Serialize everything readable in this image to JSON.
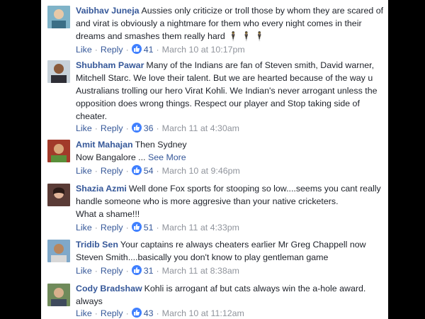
{
  "actions": {
    "like": "Like",
    "reply": "Reply"
  },
  "colors": {
    "name": "#365899",
    "like_badge": "#4080ff",
    "meta": "#90949c"
  },
  "comments": [
    {
      "name": "Vaibhav Juneja",
      "text": "Aussies only criticize or troll those by whom they are scared of and virat is obviously a nightmare for them who every night comes in their dreams and smashes them really hard",
      "emoji": "🕴🕴🕴",
      "likes": "41",
      "time": "March 10 at 10:17pm"
    },
    {
      "name": "Shubham Pawar",
      "text": "Many of the Indians are fan of Steven smith, David warner, Mitchell Starc. We love their talent. But we are hearted because of the way u Australians trolling our hero Virat Kohli. We Indian's never arrogant unless the opposition does wrong things. Respect our player and Stop taking side of cheater.",
      "likes": "36",
      "time": "March 11 at 4:30am"
    },
    {
      "name": "Amit Mahajan",
      "text": "Then Sydney",
      "text2": "Now Bangalore ...",
      "see_more": "See More",
      "likes": "54",
      "time": "March 10 at 9:46pm"
    },
    {
      "name": "Shazia Azmi",
      "text": "Well done Fox sports for stooping so low....seems you cant really handle someone who is more aggresive than your native cricketers.",
      "text2": "What a shame!!!",
      "likes": "51",
      "time": "March 11 at 4:33pm"
    },
    {
      "name": "Tridib Sen",
      "text": "Your captains re always cheaters earlier Mr Greg Chappell now Steven Smith....basically you don't know to play gentleman game",
      "likes": "31",
      "time": "March 11 at 8:38am"
    },
    {
      "name": "Cody Bradshaw",
      "text": "Kohli is arrogant af but cats always win the a-hole award.",
      "text2": "always",
      "likes": "43",
      "time": "March 10 at 11:12am"
    }
  ]
}
